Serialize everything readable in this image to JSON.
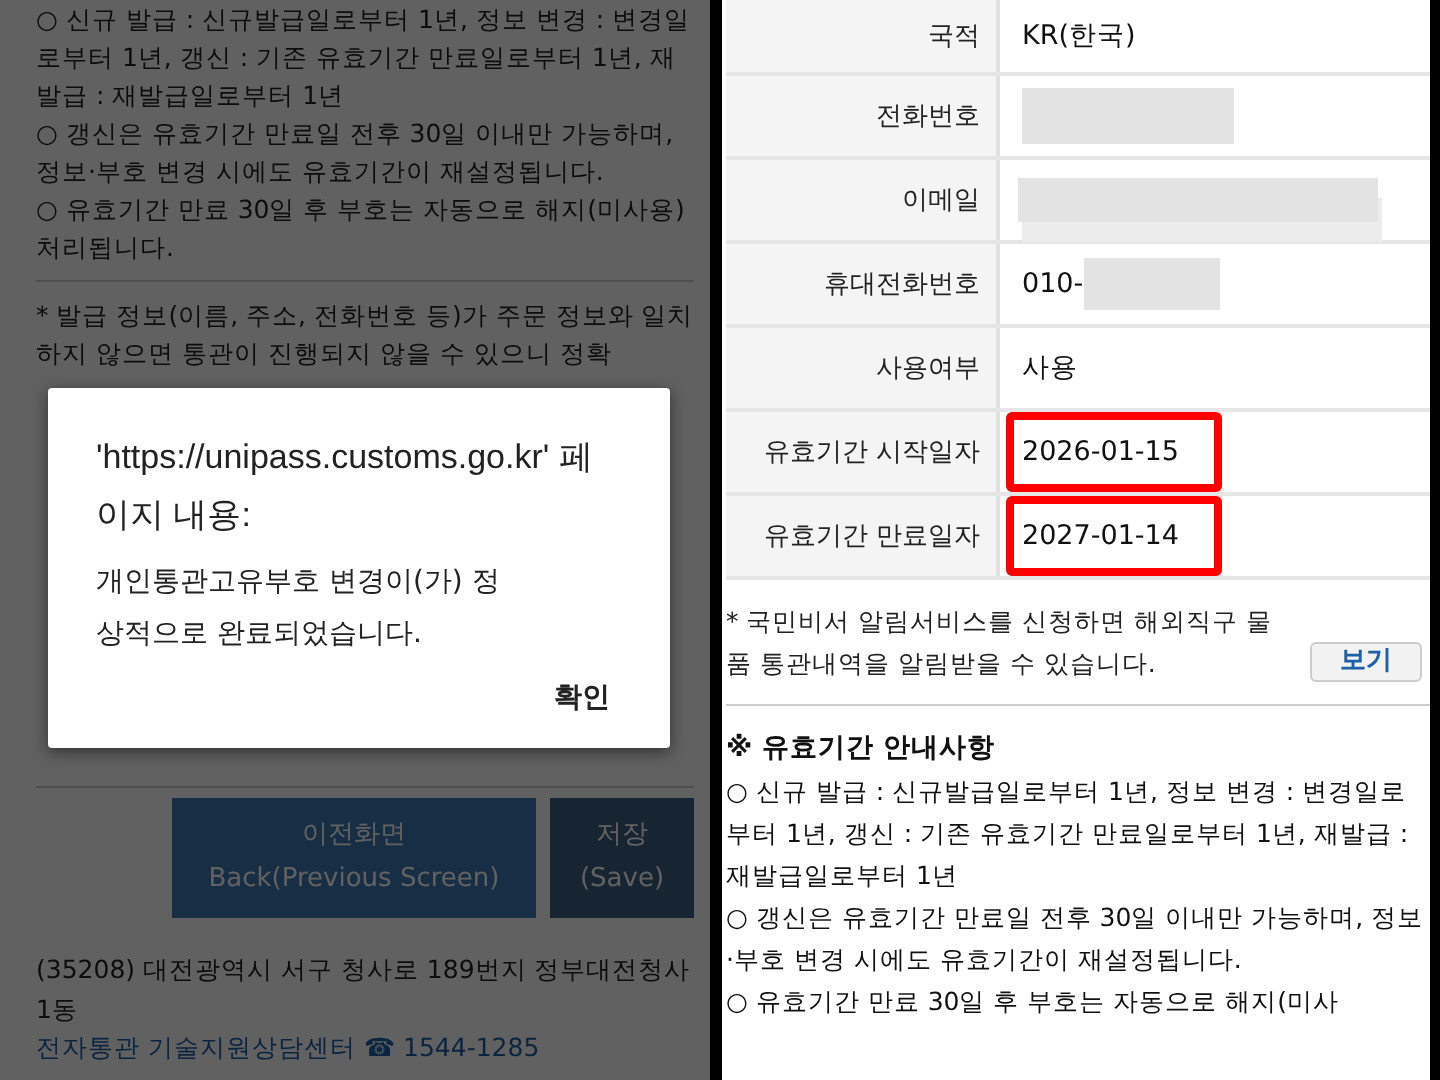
{
  "left_screen": {
    "notice_lines": [
      "○ 신규 발급 : 신규발급일로부터 1년, 정보 변경 : 변경일로부터 1년, 갱신 : 기존 유효기간 만료일로부터 1년, 재발급 : 재발급일로부터 1년",
      "○ 갱신은 유효기간 만료일 전후 30일 이내만 가능하며, 정보·부호 변경 시에도 유효기간이 재설정됩니다.",
      "○ 유효기간 만료 30일 후 부호는 자동으로 해지(미사용) 처리됩니다."
    ],
    "warning": "* 발급 정보(이름, 주소, 전화번호 등)가 주문 정보와 일치하지 않으면 통관이 진행되지 않을 수 있으니 정확",
    "buttons": [
      {
        "label": "이전화면",
        "sublabel": "Back(Previous Screen)",
        "kind": "primary"
      },
      {
        "label": "저장",
        "sublabel": "(Save)",
        "kind": "secondary"
      }
    ],
    "address": "(35208) 대전광역시 서구 청사로 189번지 정부대전청사 1동",
    "helpdesk": {
      "label": "전자통관 기술지원상담센터",
      "phone": "☎ 1544-1285"
    },
    "dialog": {
      "title": "'https://unipass.customs.go.kr' 페이지 내용:",
      "message": "개인통관고유부호 변경이(가) 정상적으로 완료되었습니다.",
      "button": "확인"
    }
  },
  "right_screen": {
    "rows": [
      {
        "label": "국적",
        "kind": "text",
        "value": "KR(한국)",
        "highlighted": false
      },
      {
        "label": "전화번호",
        "kind": "redacted",
        "highlighted": false
      },
      {
        "label": "이메일",
        "kind": "redacted_long",
        "highlighted": false
      },
      {
        "label": "휴대전화번호",
        "kind": "partial",
        "value": "010-",
        "highlighted": false
      },
      {
        "label": "사용여부",
        "kind": "text",
        "value": "사용",
        "highlighted": false
      },
      {
        "label": "유효기간 시작일자",
        "kind": "text",
        "value": "2026-01-15",
        "highlighted": true
      },
      {
        "label": "유효기간 만료일자",
        "kind": "text",
        "value": "2027-01-14",
        "highlighted": true
      }
    ],
    "note": "* 국민비서 알림서비스를 신청하면 해외직구 물품 통관내역을 알림받을 수 있습니다.",
    "note_button": "보기",
    "notice_title": "※ 유효기간 안내사항",
    "notice_lines": [
      "○ 신규 발급 : 신규발급일로부터 1년, 정보 변경 : 변경일로부터 1년, 갱신 : 기존 유효기간 만료일로부터 1년, 재발급 : 재발급일로부터 1년",
      "○ 갱신은 유효기간 만료일 전후 30일 이내만 가능하며, 정보·부호 변경 시에도 유효기간이 재설정됩니다.",
      "○ 유효기간 만료 30일 후 부호는 자동으로 해지(미사"
    ]
  }
}
